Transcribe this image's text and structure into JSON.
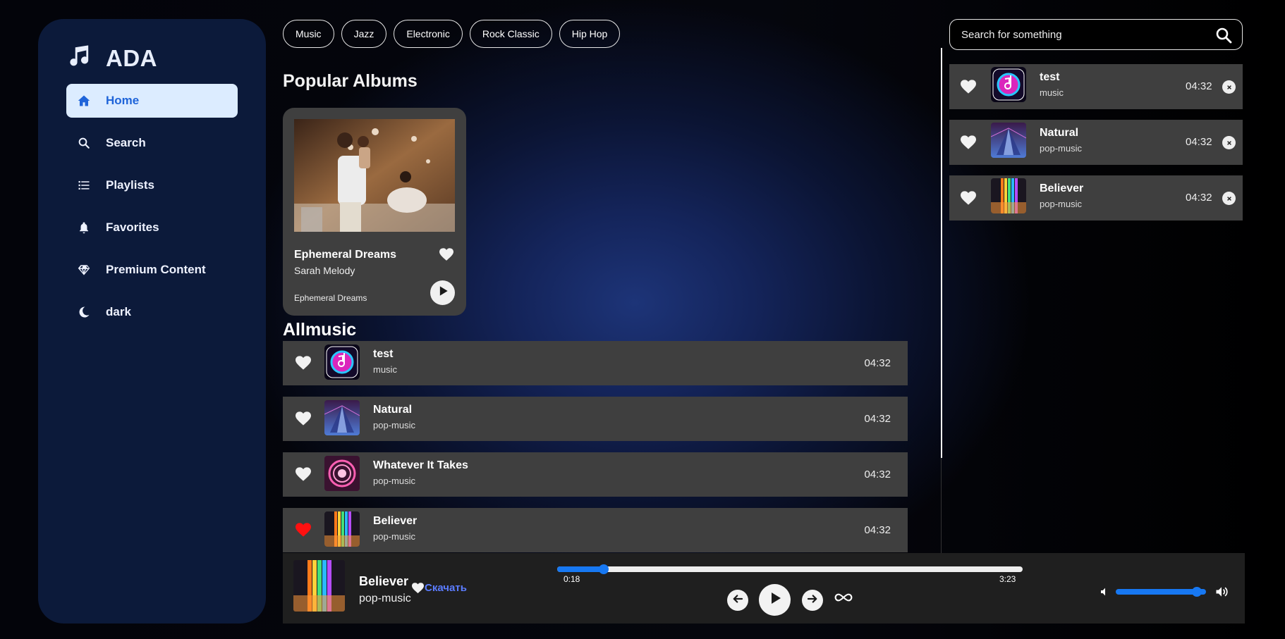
{
  "brand": {
    "name": "ADA",
    "icon": "music-note-icon"
  },
  "nav": [
    {
      "label": "Home",
      "icon": "home-icon",
      "active": true
    },
    {
      "label": "Search",
      "icon": "search-icon"
    },
    {
      "label": "Playlists",
      "icon": "list-icon"
    },
    {
      "label": "Favorites",
      "icon": "bell-icon"
    },
    {
      "label": "Premium Content",
      "icon": "diamond-icon"
    },
    {
      "label": "dark",
      "icon": "moon-icon"
    }
  ],
  "genres": [
    "Music",
    "Jazz",
    "Electronic",
    "Rock Classic",
    "Hip Hop"
  ],
  "popular": {
    "title": "Popular Albums",
    "album": {
      "title": "Ephemeral Dreams",
      "artist": "Sarah Melody",
      "subtitle": "Ephemeral Dreams"
    }
  },
  "allmusic": {
    "title": "Allmusic",
    "tracks": [
      {
        "name": "test",
        "genre": "music",
        "duration": "04:32",
        "liked": false
      },
      {
        "name": "Natural",
        "genre": "pop-music",
        "duration": "04:32",
        "liked": false
      },
      {
        "name": "Whatever It Takes",
        "genre": "pop-music",
        "duration": "04:32",
        "liked": false
      },
      {
        "name": "Believer",
        "genre": "pop-music",
        "duration": "04:32",
        "liked": true
      }
    ]
  },
  "search": {
    "placeholder": "Search for something"
  },
  "queue": [
    {
      "name": "test",
      "genre": "music",
      "duration": "04:32"
    },
    {
      "name": "Natural",
      "genre": "pop-music",
      "duration": "04:32"
    },
    {
      "name": "Believer",
      "genre": "pop-music",
      "duration": "04:32"
    }
  ],
  "player": {
    "title": "Believer",
    "genre": "pop-music",
    "download_label": "Скачать",
    "current_time": "0:18",
    "total_time": "3:23",
    "progress": 0.1,
    "volume": 0.9
  },
  "colors": {
    "accent": "#1778f2",
    "active_nav_bg": "#dcecff",
    "active_nav_text": "#1f64d9",
    "liked_heart": "#ff1010",
    "download_link": "#5b7cff",
    "row_bg": "#3f3f3f",
    "sidebar_bg": "#0c1a3a"
  }
}
